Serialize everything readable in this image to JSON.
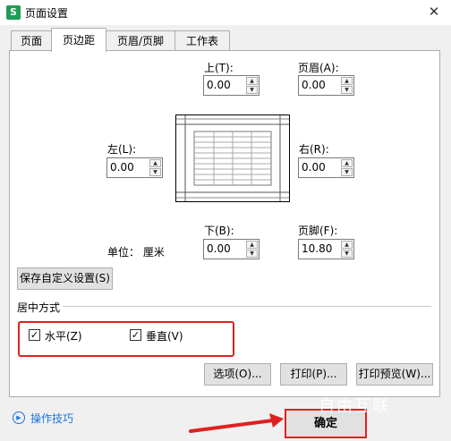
{
  "window": {
    "app_icon": "S",
    "title": "页面设置",
    "close_glyph": "✕"
  },
  "tabs": [
    "页面",
    "页边距",
    "页眉/页脚",
    "工作表"
  ],
  "margins": {
    "top": {
      "label": "上(T):",
      "value": "0.00"
    },
    "header": {
      "label": "页眉(A):",
      "value": "0.00"
    },
    "left": {
      "label": "左(L):",
      "value": "0.00"
    },
    "right": {
      "label": "右(R):",
      "value": "0.00"
    },
    "bottom": {
      "label": "下(B):",
      "value": "0.00"
    },
    "footer": {
      "label": "页脚(F):",
      "value": "10.80"
    }
  },
  "unit": "单位： 厘米",
  "save_custom": "保存自定义设置(S)",
  "center": {
    "title": "居中方式",
    "horizontal": {
      "label": "水平(Z)",
      "checked": true
    },
    "vertical": {
      "label": "垂直(V)",
      "checked": true
    }
  },
  "buttons": {
    "options": "选项(O)...",
    "print": "打印(P)...",
    "preview": "打印预览(W)...",
    "ok": "确定"
  },
  "tips": "操作技巧",
  "watermark": "自由互联",
  "colors": {
    "highlight": "#e02020",
    "link": "#1a73e8"
  }
}
